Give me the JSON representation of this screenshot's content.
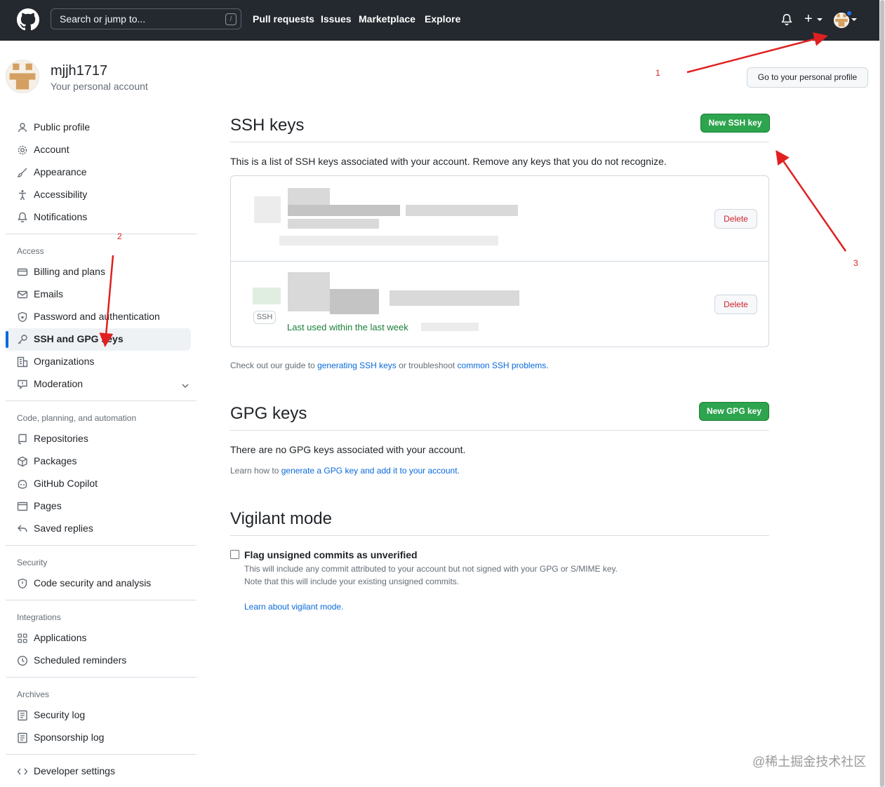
{
  "header": {
    "search_placeholder": "Search or jump to...",
    "search_shortcut": "/",
    "nav": [
      "Pull requests",
      "Issues",
      "Marketplace",
      "Explore"
    ],
    "plus_label": "+"
  },
  "user": {
    "name": "mjjh1717",
    "subtitle": "Your personal account",
    "profile_button": "Go to your personal profile"
  },
  "sidebar": {
    "top_items": [
      {
        "label": "Public profile",
        "icon": "person-icon"
      },
      {
        "label": "Account",
        "icon": "gear-icon"
      },
      {
        "label": "Appearance",
        "icon": "paintbrush-icon"
      },
      {
        "label": "Accessibility",
        "icon": "accessibility-icon"
      },
      {
        "label": "Notifications",
        "icon": "bell-icon"
      }
    ],
    "access_heading": "Access",
    "access_items": [
      {
        "label": "Billing and plans",
        "icon": "credit-card-icon"
      },
      {
        "label": "Emails",
        "icon": "mail-icon"
      },
      {
        "label": "Password and authentication",
        "icon": "shield-lock-icon"
      },
      {
        "label": "SSH and GPG keys",
        "icon": "key-icon"
      },
      {
        "label": "Organizations",
        "icon": "organization-icon"
      },
      {
        "label": "Moderation",
        "icon": "report-icon"
      }
    ],
    "code_heading": "Code, planning, and automation",
    "code_items": [
      {
        "label": "Repositories",
        "icon": "repo-icon"
      },
      {
        "label": "Packages",
        "icon": "package-icon"
      },
      {
        "label": "GitHub Copilot",
        "icon": "copilot-icon"
      },
      {
        "label": "Pages",
        "icon": "browser-icon"
      },
      {
        "label": "Saved replies",
        "icon": "reply-icon"
      }
    ],
    "security_heading": "Security",
    "security_items": [
      {
        "label": "Code security and analysis",
        "icon": "shield-icon"
      }
    ],
    "integrations_heading": "Integrations",
    "integrations_items": [
      {
        "label": "Applications",
        "icon": "apps-icon"
      },
      {
        "label": "Scheduled reminders",
        "icon": "clock-icon"
      }
    ],
    "archives_heading": "Archives",
    "archives_items": [
      {
        "label": "Security log",
        "icon": "log-icon"
      },
      {
        "label": "Sponsorship log",
        "icon": "log-icon"
      }
    ],
    "developer_settings": "Developer settings",
    "active_item": "SSH and GPG keys"
  },
  "ssh": {
    "title": "SSH keys",
    "new_button": "New SSH key",
    "description": "This is a list of SSH keys associated with your account. Remove any keys that you do not recognize.",
    "delete_label": "Delete",
    "badge": "SSH",
    "last_used": "Last used within the last week",
    "help_prefix": "Check out our guide to ",
    "help_link1": "generating SSH keys",
    "help_middle": " or troubleshoot ",
    "help_link2": "common SSH problems."
  },
  "gpg": {
    "title": "GPG keys",
    "new_button": "New GPG key",
    "empty": "There are no GPG keys associated with your account.",
    "learn_prefix": "Learn how to ",
    "learn_link": "generate a GPG key and add it to your account."
  },
  "vigilant": {
    "title": "Vigilant mode",
    "checkbox_label": "Flag unsigned commits as unverified",
    "checked": false,
    "desc1": "This will include any commit attributed to your account but not signed with your GPG or S/MIME key.",
    "desc2": "Note that this will include your existing unsigned commits.",
    "learn_link": "Learn about vigilant mode."
  },
  "annotations": [
    "1",
    "2",
    "3"
  ],
  "watermark": "@稀土掘金技术社区",
  "colors": {
    "header_bg": "#24292f",
    "primary_button": "#2da44e",
    "link": "#0969da",
    "danger": "#cf222e",
    "annotation": "#e02020",
    "active_indicator": "#0969da"
  }
}
